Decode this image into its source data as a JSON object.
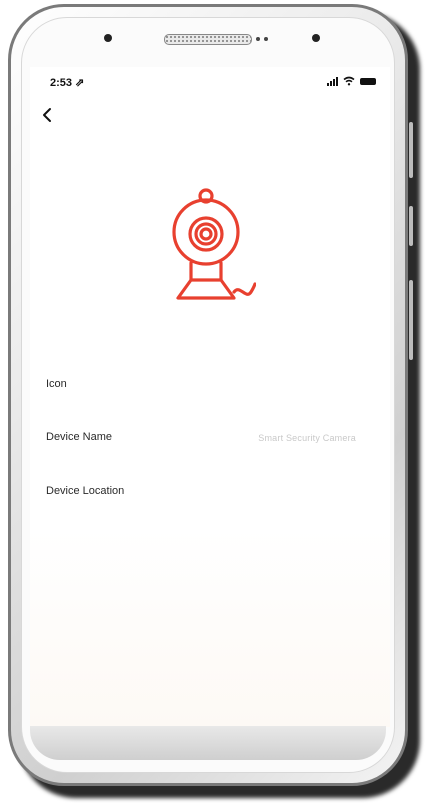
{
  "status_bar": {
    "time": "2:53 ⇗"
  },
  "header": {
    "back_icon": "chevron-left-icon"
  },
  "device": {
    "icon": "webcam-icon",
    "icon_color": "#e8402f"
  },
  "settings": {
    "icon_label": "Icon",
    "name_label": "Device Name",
    "name_value": "Smart Security Camera",
    "location_label": "Device Location"
  }
}
